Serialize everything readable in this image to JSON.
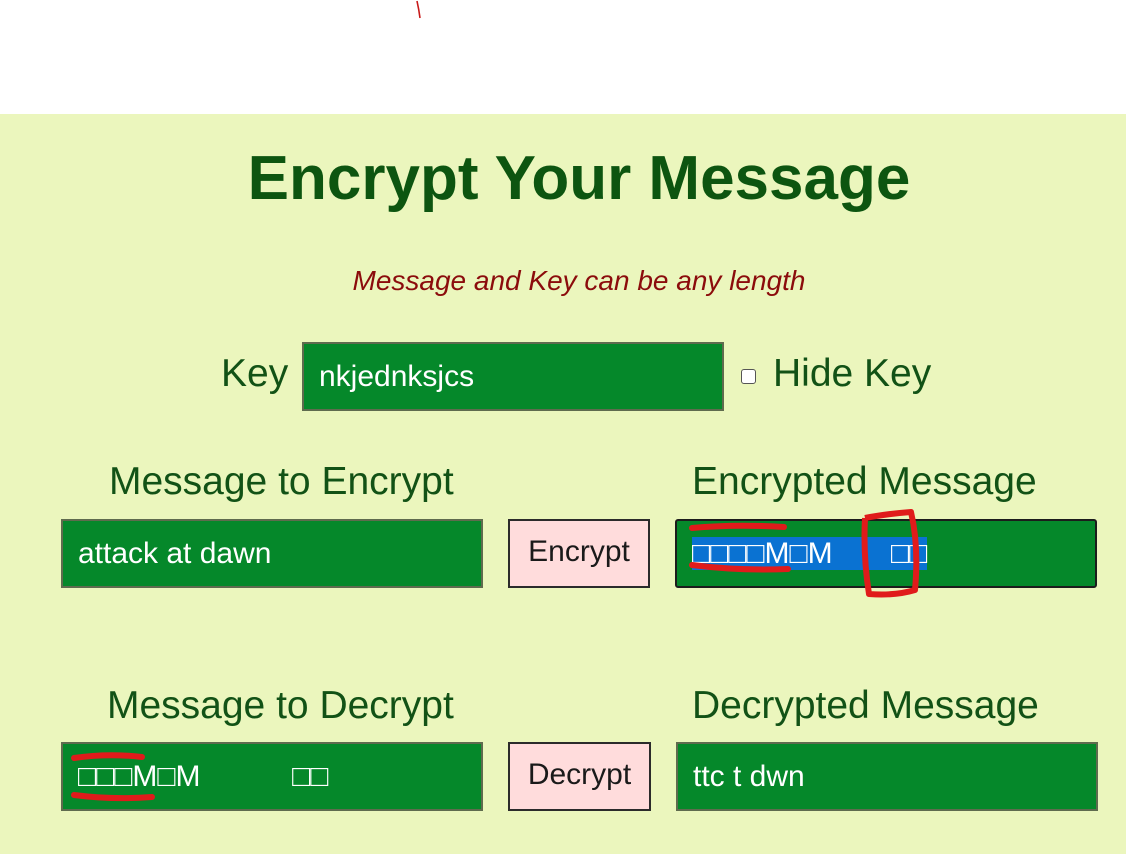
{
  "header": {
    "title": "Encrypt Your Message",
    "subtitle": "Message and Key can be any length"
  },
  "key": {
    "label": "Key",
    "value": "nkjednksjcs",
    "hide_label": "Hide Key",
    "hide_checked": false
  },
  "encrypt": {
    "input_label": "Message to Encrypt",
    "input_value": "attack at dawn",
    "button_label": "Encrypt",
    "output_label": "Encrypted Message",
    "output_value_selected": "□□□□M□M",
    "output_value_selected_tail": "□□"
  },
  "decrypt": {
    "input_label": "Message to Decrypt",
    "input_value": "□□□M□M",
    "input_value_tail": "□□",
    "button_label": "Decrypt",
    "output_label": "Decrypted Message",
    "output_value": "ttc t dwn"
  },
  "colors": {
    "panel_bg": "#ebf6bd",
    "title": "#0d5510",
    "subtitle": "#8b0c0c",
    "field_bg": "#05882a",
    "button_bg": "#ffdcdc",
    "selection": "#0a72d2",
    "annotation": "#e01b1b"
  }
}
